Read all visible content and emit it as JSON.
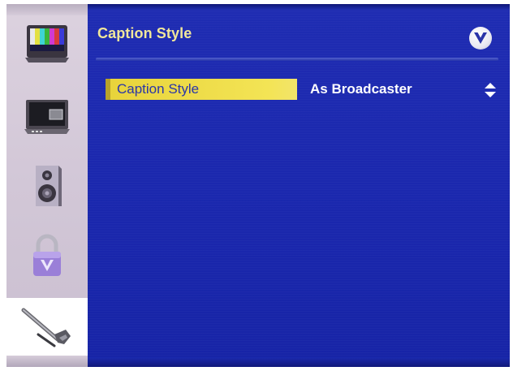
{
  "screen": {
    "title": "Caption Style"
  },
  "sidebar": {
    "items": [
      {
        "icon": "tv-color-bars-icon",
        "selected": false
      },
      {
        "icon": "picture-in-picture-icon",
        "selected": false
      },
      {
        "icon": "speaker-icon",
        "selected": false
      },
      {
        "icon": "lock-icon",
        "selected": false
      },
      {
        "icon": "wrench-icon",
        "selected": true
      }
    ]
  },
  "menu": {
    "rows": [
      {
        "label": "Caption Style",
        "value": "As Broadcaster",
        "control": "up-down-arrows-icon"
      }
    ]
  },
  "colors": {
    "panel_blue": "#1f2cb2",
    "title_yellow": "#f1e79a",
    "highlight_yellow": "#f3e455",
    "sidebar_lavender": "#d4cad9"
  },
  "brand": {
    "logo": "vizio-v-logo-icon"
  }
}
